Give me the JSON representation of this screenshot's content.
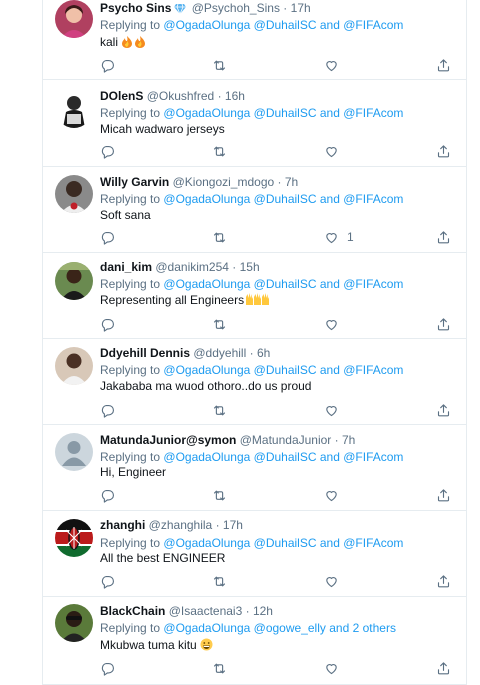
{
  "tweets": [
    {
      "name": "Psycho Sins",
      "verified": true,
      "handle": "@Psychoh_Sins",
      "sep": "·",
      "time": "17h",
      "reply_prefix": "Replying to",
      "reply_mentions": [
        "@OgadaOlunga",
        "@DuhailSC",
        "and",
        "@FIFAcom"
      ],
      "text": "kali",
      "text_emoji": "fire-fire",
      "likes": ""
    },
    {
      "name": "DOlenS",
      "handle": "@Okushfred",
      "sep": "·",
      "time": "16h",
      "reply_prefix": "Replying to",
      "reply_mentions": [
        "@OgadaOlunga",
        "@DuhailSC",
        "and",
        "@FIFAcom"
      ],
      "text": "Micah wadwaro jerseys",
      "likes": ""
    },
    {
      "name": "Willy Garvin",
      "handle": "@Kiongozi_mdogo",
      "sep": "·",
      "time": "7h",
      "reply_prefix": "Replying to",
      "reply_mentions": [
        "@OgadaOlunga",
        "@DuhailSC",
        "and",
        "@FIFAcom"
      ],
      "text": "Soft sana",
      "likes": "1"
    },
    {
      "name": "dani_kim",
      "handle": "@danikim254",
      "sep": "·",
      "time": "15h",
      "reply_prefix": "Replying to",
      "reply_mentions": [
        "@OgadaOlunga",
        "@DuhailSC",
        "and",
        "@FIFAcom"
      ],
      "text": "Representing all Engineers",
      "text_emoji": "raised-hands-x2",
      "likes": ""
    },
    {
      "name": "Ddyehill Dennis",
      "handle": "@ddyehill",
      "sep": "·",
      "time": "6h",
      "reply_prefix": "Replying to",
      "reply_mentions": [
        "@OgadaOlunga",
        "@DuhailSC",
        "and",
        "@FIFAcom"
      ],
      "text": "Jakababa ma wuod othoro..do us proud",
      "likes": ""
    },
    {
      "name": "MatundaJunior@symon",
      "handle": "@MatundaJunior",
      "sep": "·",
      "time": "7h",
      "reply_prefix": "Replying to",
      "reply_mentions": [
        "@OgadaOlunga",
        "@DuhailSC",
        "and",
        "@FIFAcom"
      ],
      "text": "Hi, Engineer",
      "likes": ""
    },
    {
      "name": "zhanghi",
      "handle": "@zhanghila",
      "sep": "·",
      "time": "17h",
      "reply_prefix": "Replying to",
      "reply_mentions": [
        "@OgadaOlunga",
        "@DuhailSC",
        "and",
        "@FIFAcom"
      ],
      "text": "All the best ENGINEER",
      "likes": ""
    },
    {
      "name": "BlackChain",
      "handle": "@Isaactenai3",
      "sep": "·",
      "time": "12h",
      "reply_prefix": "Replying to",
      "reply_mentions": [
        "@OgadaOlunga",
        "@ogowe_elly",
        "and",
        "2 others"
      ],
      "text": "Mkubwa tuma kitu",
      "text_emoji": "grinning-face",
      "likes": ""
    }
  ],
  "colors": {
    "text": "#0f1419",
    "secondary": "#5b7083",
    "link": "#1d9bf0",
    "divider": "#e6ecf0",
    "verified": "#5ab4f0"
  },
  "icons": [
    "reply-icon",
    "retweet-icon",
    "like-icon",
    "share-icon"
  ]
}
